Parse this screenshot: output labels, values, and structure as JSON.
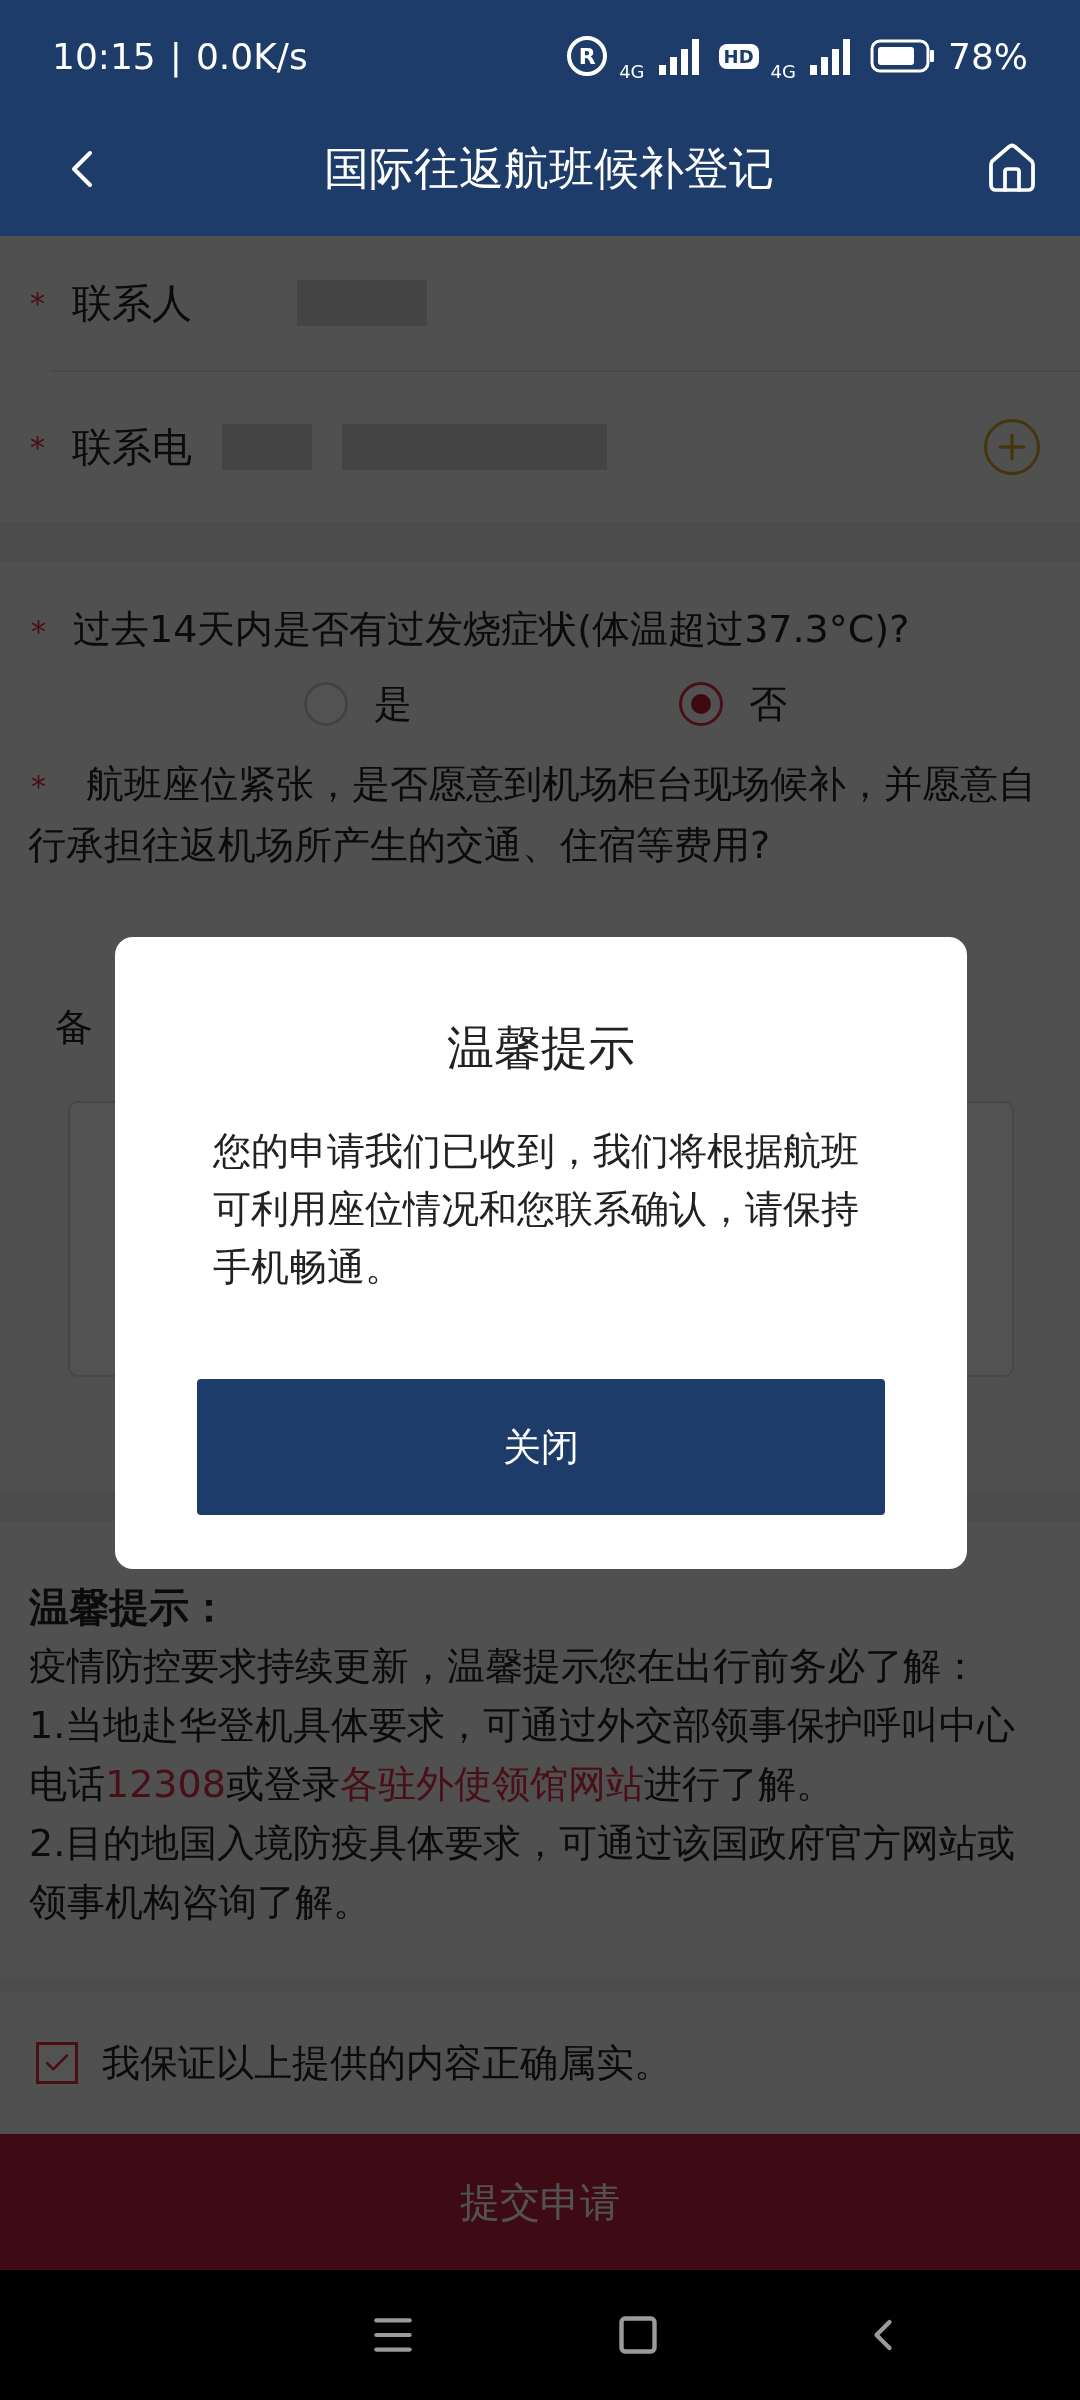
{
  "status_bar": {
    "time": "10:15",
    "separator": "|",
    "speed": "0.0K/s",
    "roaming": "R",
    "network_1": "4G",
    "hd": "HD",
    "network_2": "4G",
    "battery": "78%"
  },
  "header": {
    "title": "国际往返航班候补登记"
  },
  "contact_fields": [
    {
      "mark": "*",
      "label": "联系人",
      "kind": "text"
    },
    {
      "mark": "*",
      "label": "联系电",
      "kind": "phone"
    }
  ],
  "questions": [
    {
      "mark": "*",
      "text": "过去14天内是否有过发烧症状(体温超过37.3°C)?",
      "options": [
        {
          "label": "是",
          "selected": false
        },
        {
          "label": "否",
          "selected": true
        }
      ]
    },
    {
      "mark": "*",
      "text": "航班座位紧张，是否愿意到机场柜台现场候补，并愿意自行承担往返机场所产生的交通、住宿等费用?"
    }
  ],
  "remark": {
    "label": "备"
  },
  "tips": {
    "title": "温馨提示：",
    "lines": [
      [
        {
          "text": "疫情防控要求持续更新，温馨提示您在出行前务必了解："
        }
      ],
      [
        {
          "text": "1.当地赴华登机具体要求，可通过外交部领事保护呼叫中心电话"
        },
        {
          "text": "12308",
          "link": true
        },
        {
          "text": "或登录"
        },
        {
          "text": "各驻外使领馆网站",
          "link": true
        },
        {
          "text": "进行了解。"
        }
      ],
      [
        {
          "text": "2.目的地国入境防疫具体要求，可通过该国政府官方网站或领事机构咨询了解。"
        }
      ]
    ]
  },
  "agreement": {
    "text": "我保证以上提供的内容正确属实。",
    "checked": true
  },
  "submit": {
    "label": "提交申请"
  },
  "dialog": {
    "title": "温馨提示",
    "message": "您的申请我们已收到，我们将根据航班可利用座位情况和您联系确认，请保持手机畅通。",
    "button": "关闭"
  }
}
